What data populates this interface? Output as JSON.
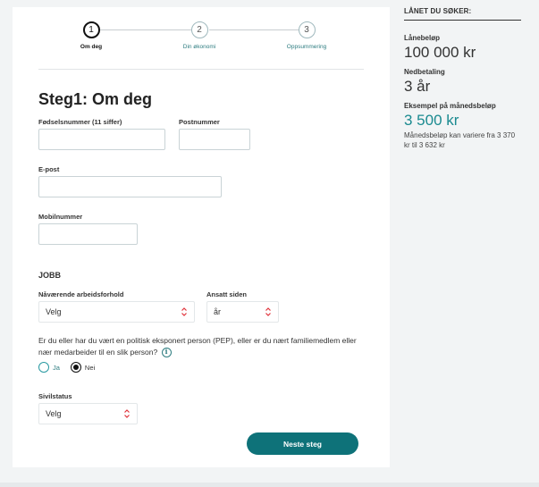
{
  "stepper": {
    "steps": [
      {
        "number": "1",
        "label": "Om deg"
      },
      {
        "number": "2",
        "label": "Din økonomi"
      },
      {
        "number": "3",
        "label": "Oppsummering"
      }
    ]
  },
  "form": {
    "title": "Steg1: Om deg",
    "fodselsnummer_label": "Fødselsnummer (11 siffer)",
    "postnummer_label": "Postnummer",
    "epost_label": "E-post",
    "mobil_label": "Mobilnummer",
    "fodselsnummer_value": "",
    "postnummer_value": "",
    "epost_value": "",
    "mobil_value": ""
  },
  "job": {
    "section_title": "JOBB",
    "arbeidsforhold_label": "Nåværende arbeidsforhold",
    "arbeidsforhold_value": "Velg",
    "ansatt_label": "Ansatt siden",
    "ansatt_value": "år"
  },
  "pep": {
    "question": "Er du eller har du vært en politisk eksponert person (PEP), eller er du nært familiemedlem eller nær medarbeider til en slik person?",
    "info_glyph": "i",
    "options": [
      {
        "label": "Ja",
        "checked": false
      },
      {
        "label": "Nei",
        "checked": true
      }
    ]
  },
  "sivilstatus": {
    "label": "Sivilstatus",
    "value": "Velg"
  },
  "actions": {
    "next_label": "Neste steg"
  },
  "summary": {
    "heading": "LÅNET DU SØKER:",
    "amount_label": "Lånebeløp",
    "amount_value": "100 000 kr",
    "term_label": "Nedbetaling",
    "term_value": "3 år",
    "monthly_label": "Eksempel på månedsbeløp",
    "monthly_value": "3 500 kr",
    "monthly_note": "Månedsbeløp kan variere fra 3 370 kr til 3 632 kr"
  },
  "colors": {
    "accent": "#0e7279",
    "accent_text": "#1a8a90",
    "chevron": "#e0323a"
  }
}
